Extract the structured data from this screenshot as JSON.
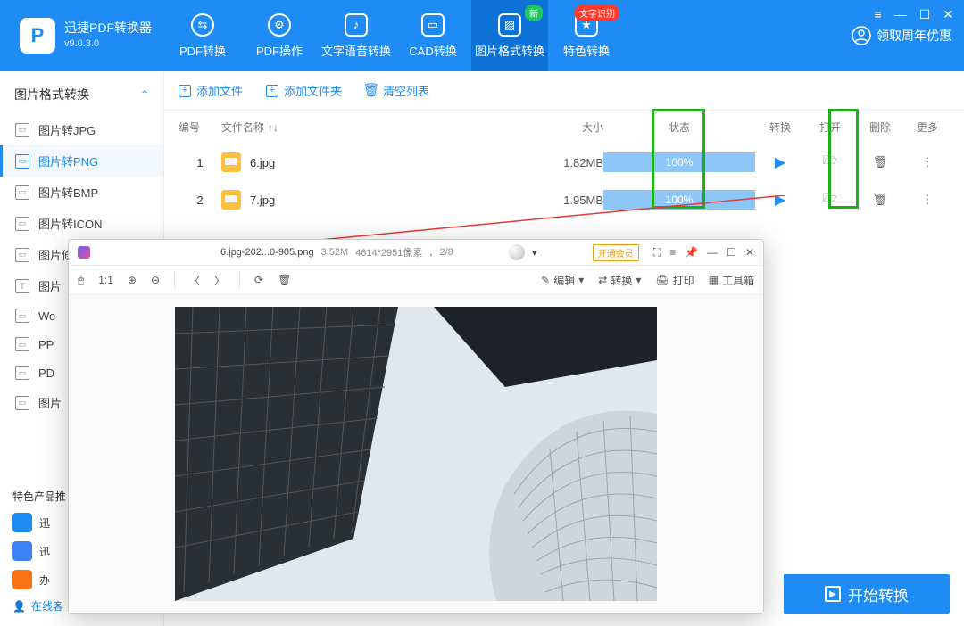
{
  "app": {
    "name": "迅捷PDF转换器",
    "version": "v9.0.3.0"
  },
  "window_controls": {
    "menu": "≡",
    "min": "—",
    "max": "☐",
    "close": "✕"
  },
  "header_nav": [
    {
      "label": "PDF转换"
    },
    {
      "label": "PDF操作"
    },
    {
      "label": "文字语音转换"
    },
    {
      "label": "CAD转换"
    },
    {
      "label": "图片格式转换",
      "active": true,
      "badge": "新",
      "badge_green": true
    },
    {
      "label": "特色转换",
      "badge": "文字识别"
    }
  ],
  "claim_label": "领取周年优惠",
  "sidebar": {
    "category": "图片格式转换",
    "items": [
      {
        "label": "图片转JPG"
      },
      {
        "label": "图片转PNG",
        "active": true
      },
      {
        "label": "图片转BMP"
      },
      {
        "label": "图片转ICON"
      },
      {
        "label": "图片修改尺寸"
      },
      {
        "label": "图片"
      },
      {
        "label": "Wo"
      },
      {
        "label": "PP"
      },
      {
        "label": "PD"
      },
      {
        "label": "图片"
      }
    ],
    "foot_title": "特色产品推",
    "foot_items": [
      {
        "label": "迅"
      },
      {
        "label": "迅"
      },
      {
        "label": "办"
      }
    ],
    "online": "在线客"
  },
  "toolbar": {
    "add_file": "添加文件",
    "add_folder": "添加文件夹",
    "clear": "清空列表"
  },
  "table": {
    "head": {
      "idx": "编号",
      "name": "文件名称",
      "size": "大小",
      "status": "状态",
      "convert": "转换",
      "open": "打开",
      "delete": "删除",
      "more": "更多"
    },
    "rows": [
      {
        "idx": "1",
        "name": "6.jpg",
        "size": "1.82MB",
        "status": "100%"
      },
      {
        "idx": "2",
        "name": "7.jpg",
        "size": "1.95MB",
        "status": "100%"
      }
    ]
  },
  "start_button": "开始转换",
  "viewer": {
    "filename": "6.jpg-202...0-905.png",
    "filesize": "3.52M",
    "dimensions": "4614*2951像素",
    "page": "2/8",
    "vip": "开通会员",
    "edit": "编辑",
    "convert": "转换",
    "print": "打印",
    "toolbox": "工具箱",
    "ratio": "1:1"
  }
}
